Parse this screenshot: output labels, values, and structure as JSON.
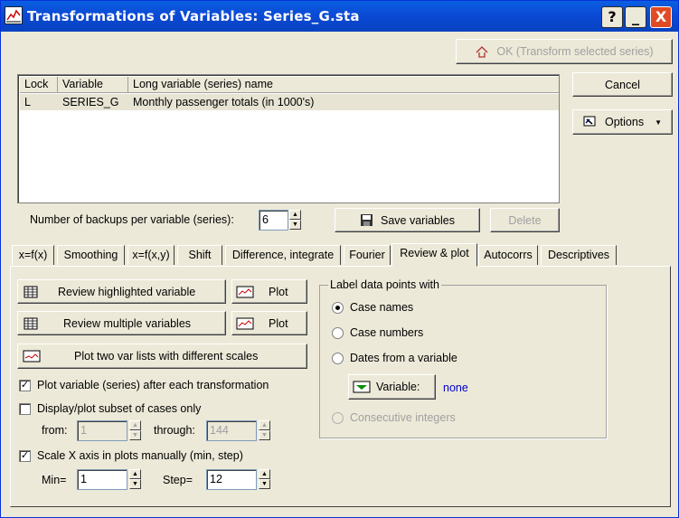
{
  "window": {
    "title": "Transformations of Variables: Series_G.sta",
    "help": "?",
    "minimize": "_",
    "close": "X"
  },
  "buttons": {
    "ok": "OK (Transform selected series)",
    "cancel": "Cancel",
    "options": "Options",
    "save_variables": "Save variables",
    "delete": "Delete"
  },
  "table": {
    "headers": [
      "Lock",
      "Variable",
      "Long variable (series) name"
    ],
    "rows": [
      {
        "lock": "L",
        "variable": "SERIES_G",
        "name": "Monthly passenger totals (in 1000's)"
      }
    ]
  },
  "backups": {
    "label": "Number of backups per variable (series):",
    "value": "6"
  },
  "tabs": [
    "x=f(x)",
    "Smoothing",
    "x=f(x,y)",
    "Shift",
    "Difference, integrate",
    "Fourier",
    "Review & plot",
    "Autocorrs",
    "Descriptives"
  ],
  "active_tab": "Review & plot",
  "review": {
    "review_highlighted": "Review highlighted variable",
    "review_multiple": "Review multiple variables",
    "plot": "Plot",
    "plot_two_lists": "Plot two var lists with different scales",
    "plot_after_each": "Plot variable (series) after each transformation",
    "display_subset": "Display/plot subset of cases only",
    "from_label": "from:",
    "from_value": "1",
    "through_label": "through:",
    "through_value": "144",
    "scale_x": "Scale X axis in plots manually (min, step)",
    "min_label": "Min=",
    "min_value": "1",
    "step_label": "Step=",
    "step_value": "12"
  },
  "label_group": {
    "title": "Label data points with",
    "case_names": "Case names",
    "case_numbers": "Case numbers",
    "dates_from_variable": "Dates from a variable",
    "variable_button": "Variable:",
    "variable_value": "none",
    "consecutive_integers": "Consecutive integers"
  },
  "colors": {
    "titlebar": "#0b4ad6",
    "face": "#ece9d8",
    "link": "#0000cc",
    "close": "#e04b23"
  }
}
